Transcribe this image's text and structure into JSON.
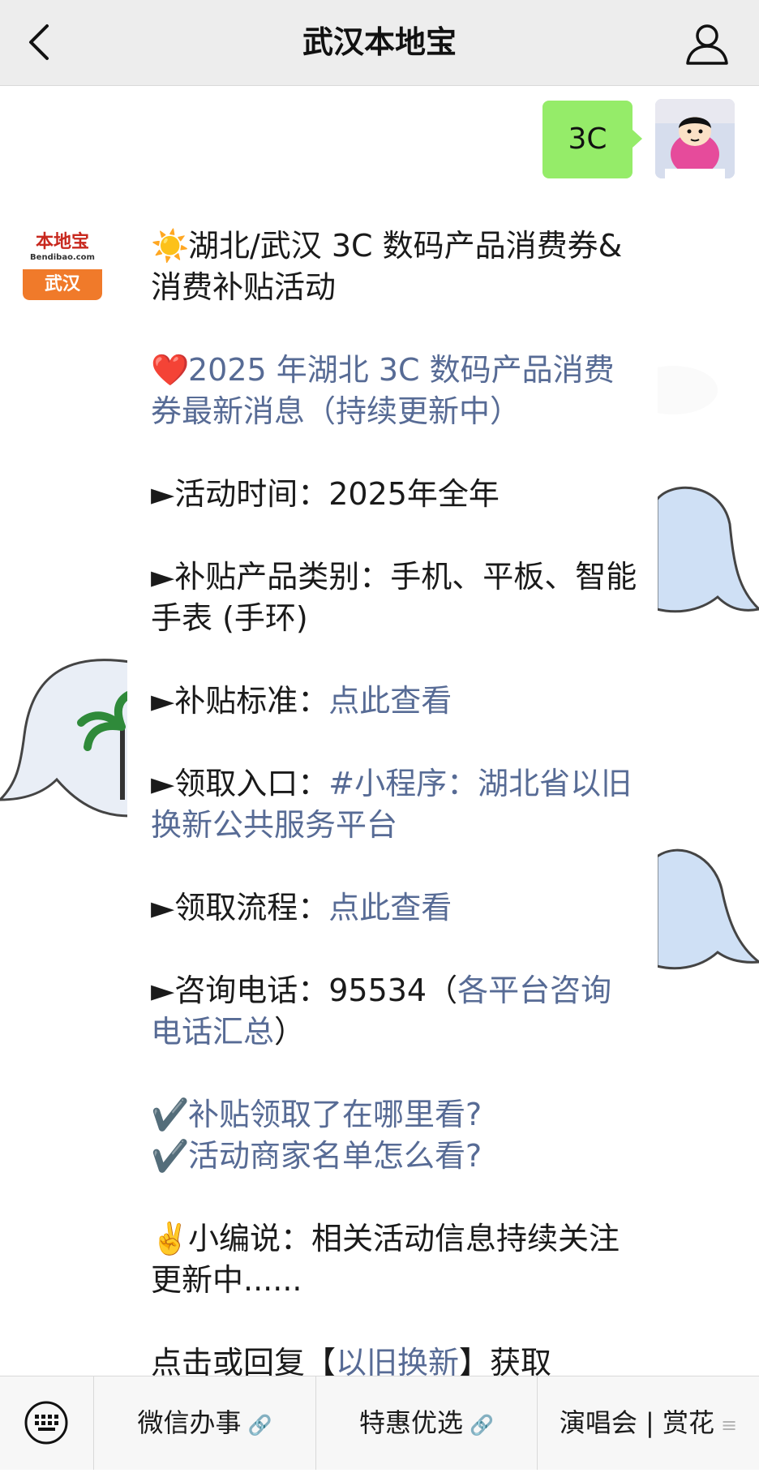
{
  "header": {
    "title": "武汉本地宝",
    "back_icon": "chevron-left-icon",
    "profile_icon": "person-icon"
  },
  "chat": {
    "user_message": "3C",
    "bot_avatar": {
      "logo_text": "本地宝",
      "logo_domain": "Bendibao.com",
      "city": "武汉"
    },
    "lines": {
      "l1": "湖北/武汉 3C 数码产品消费券&消费补贴活动",
      "l2": "2025 年湖北 3C 数码产品消费券最新消息（持续更新中）",
      "l3": "►活动时间：2025年全年",
      "l4": "►补贴产品类别：手机、平板、智能手表 (手环)",
      "l5_prefix": "►补贴标准：",
      "l5_link": "点此查看",
      "l6_prefix": "►领取入口：",
      "l6_link": "#小程序：湖北省以旧换新公共服务平台",
      "l7_prefix": "►领取流程：",
      "l7_link": "点此查看",
      "l8_prefix": "►咨询电话：95534（",
      "l8_link": "各平台咨询电话汇总",
      "l8_suffix": "）",
      "l9": "补贴领取了在哪里看?",
      "l10": "活动商家名单怎么看?",
      "l11": "小编说：相关活动信息持续关注更新中......",
      "l12_prefix": "点击或回复【",
      "l12_link": "以旧换新",
      "l12_suffix": "】获取"
    },
    "emojis": {
      "sun": "☀️",
      "heart": "❤️",
      "check": "✔️",
      "victory": "✌️"
    }
  },
  "bottom_menu": {
    "keyboard_icon": "keyboard-icon",
    "items": [
      {
        "label": "微信办事",
        "icon": "link-icon"
      },
      {
        "label": "特惠优选",
        "icon": "link-icon"
      },
      {
        "label": "演唱会 | 赏花",
        "icon": "menu-lines-icon"
      }
    ]
  },
  "colors": {
    "link": "#576b95",
    "user_bubble": "#95ec69",
    "header_bg": "#ededed",
    "logo_orange": "#f07a2a"
  }
}
